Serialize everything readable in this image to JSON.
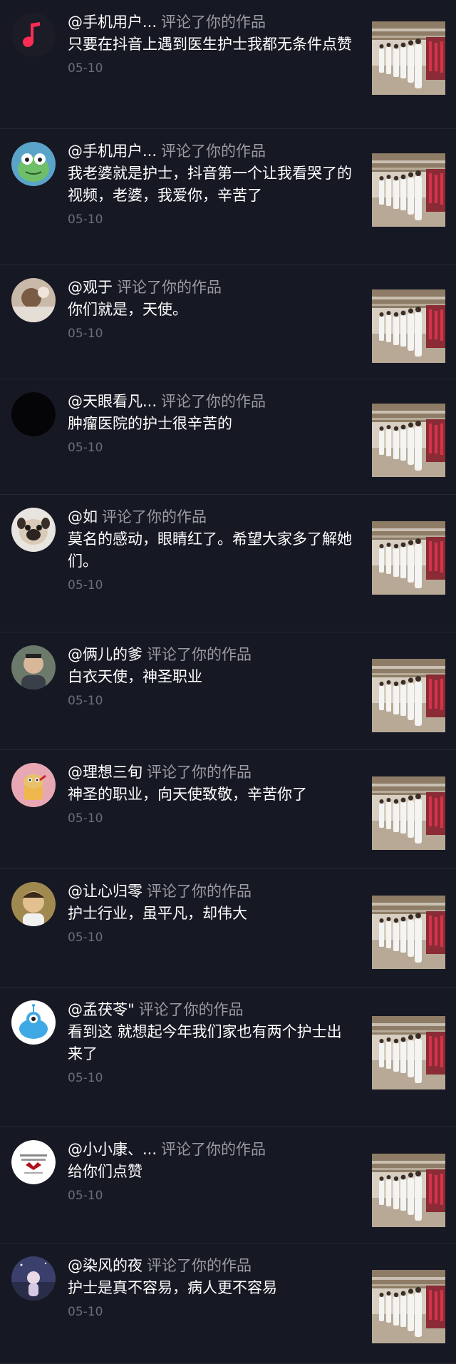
{
  "notifications": [
    {
      "user": "@手机用户...",
      "action": "评论了你的作品",
      "text": "只要在抖音上遇到医生护士我都无条件点赞",
      "date": "05-10",
      "avatar": "music-note"
    },
    {
      "user": "@手机用户...",
      "action": "评论了你的作品",
      "text": "我老婆就是护士，抖音第一个让我看哭了的视频，老婆，我爱你，辛苦了",
      "date": "05-10",
      "avatar": "frog"
    },
    {
      "user": "@观于",
      "action": "评论了你的作品",
      "text": "你们就是，天使。",
      "date": "05-10",
      "avatar": "photo-light"
    },
    {
      "user": "@天眼看凡...",
      "action": "评论了你的作品",
      "text": "肿瘤医院的护士很辛苦的",
      "date": "05-10",
      "avatar": "dark"
    },
    {
      "user": "@如",
      "action": "评论了你的作品",
      "text": "莫名的感动，眼睛红了。希望大家多了解她们。",
      "date": "05-10",
      "avatar": "dog"
    },
    {
      "user": "@俩儿的爹",
      "action": "评论了你的作品",
      "text": "白衣天使，神圣职业",
      "date": "05-10",
      "avatar": "person"
    },
    {
      "user": "@理想三旬",
      "action": "评论了你的作品",
      "text": "神圣的职业，向天使致敬，辛苦你了",
      "date": "05-10",
      "avatar": "cartoon-pink"
    },
    {
      "user": "@让心归零",
      "action": "评论了你的作品",
      "text": "护士行业，虽平凡，却伟大",
      "date": "05-10",
      "avatar": "person-warm"
    },
    {
      "user": "@孟茯苓\"",
      "action": "评论了你的作品",
      "text": "看到这  就想起今年我们家也有两个护士出来了",
      "date": "05-10",
      "avatar": "monster-blue"
    },
    {
      "user": "@小小康、...",
      "action": "评论了你的作品",
      "text": "给你们点赞",
      "date": "05-10",
      "avatar": "text-logo"
    },
    {
      "user": "@染风的夜",
      "action": "评论了你的作品",
      "text": "护士是真不容易，病人更不容易",
      "date": "05-10",
      "avatar": "night"
    }
  ]
}
